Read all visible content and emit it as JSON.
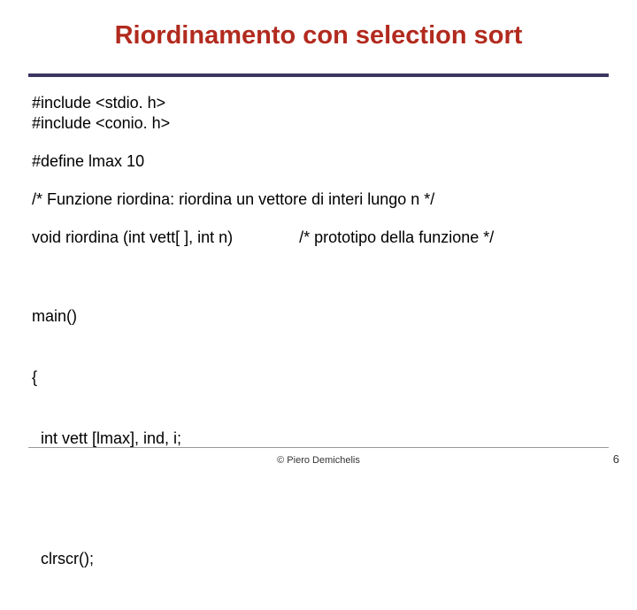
{
  "title": "Riordinamento con  selection sort",
  "code": {
    "includes_l1": "#include <stdio. h>",
    "includes_l2": "#include <conio. h>",
    "define": "#define lmax 10",
    "comment_funz": "/*   Funzione riordina: riordina un vettore di interi lungo n   */",
    "proto_left": "void riordina (int vett[ ], int n)",
    "proto_right": "/*   prototipo della funzione   */",
    "main_l1": "main()",
    "main_l2": "{",
    "main_l3": "  int vett [lmax], ind, i;",
    "clrscr": "  clrscr();"
  },
  "footer": {
    "copyright": "© Piero Demichelis",
    "page": "6"
  }
}
